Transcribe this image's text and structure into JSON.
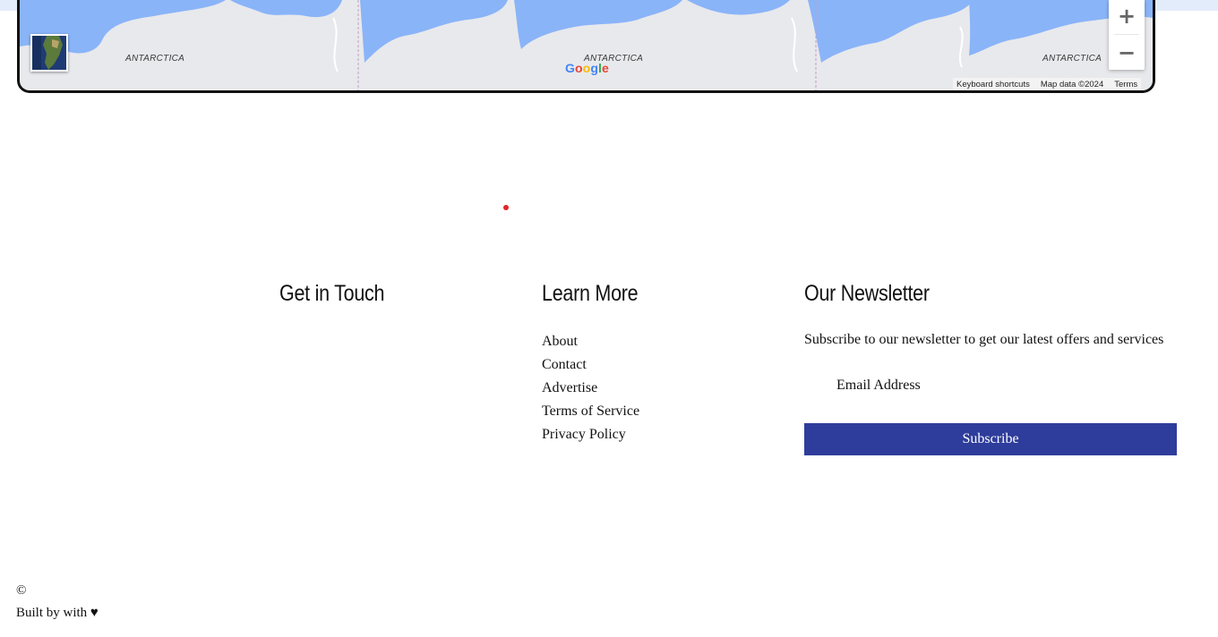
{
  "map": {
    "labels": [
      "ANTARCTICA",
      "ANTARCTICA",
      "ANTARCTICA"
    ],
    "zoom_in_label": "+",
    "zoom_out_label": "−",
    "logo": [
      "G",
      "o",
      "o",
      "g",
      "l",
      "e"
    ],
    "logo_colors": [
      "#4285F4",
      "#EA4335",
      "#FBBC05",
      "#4285F4",
      "#34A853",
      "#EA4335"
    ],
    "attribution": {
      "shortcuts": "Keyboard shortcuts",
      "data": "Map data ©2024",
      "terms": "Terms"
    },
    "colors": {
      "water": "#8ab4f8",
      "land": "#e8e9ec",
      "border_line": "#c79bc2"
    }
  },
  "footer": {
    "get_in_touch": {
      "title": "Get in Touch"
    },
    "learn_more": {
      "title": "Learn More",
      "links": [
        "About",
        "Contact",
        "Advertise",
        "Terms of Service",
        "Privacy Policy"
      ]
    },
    "newsletter": {
      "title": "Our Newsletter",
      "text": "Subscribe to our newsletter to get our latest offers and services",
      "email_placeholder": "Email Address",
      "button": "Subscribe"
    },
    "copyright": "©",
    "built_by": "Built by with ♥"
  },
  "colors": {
    "accent": "#2e3d9b",
    "marker": "#e2242a"
  }
}
